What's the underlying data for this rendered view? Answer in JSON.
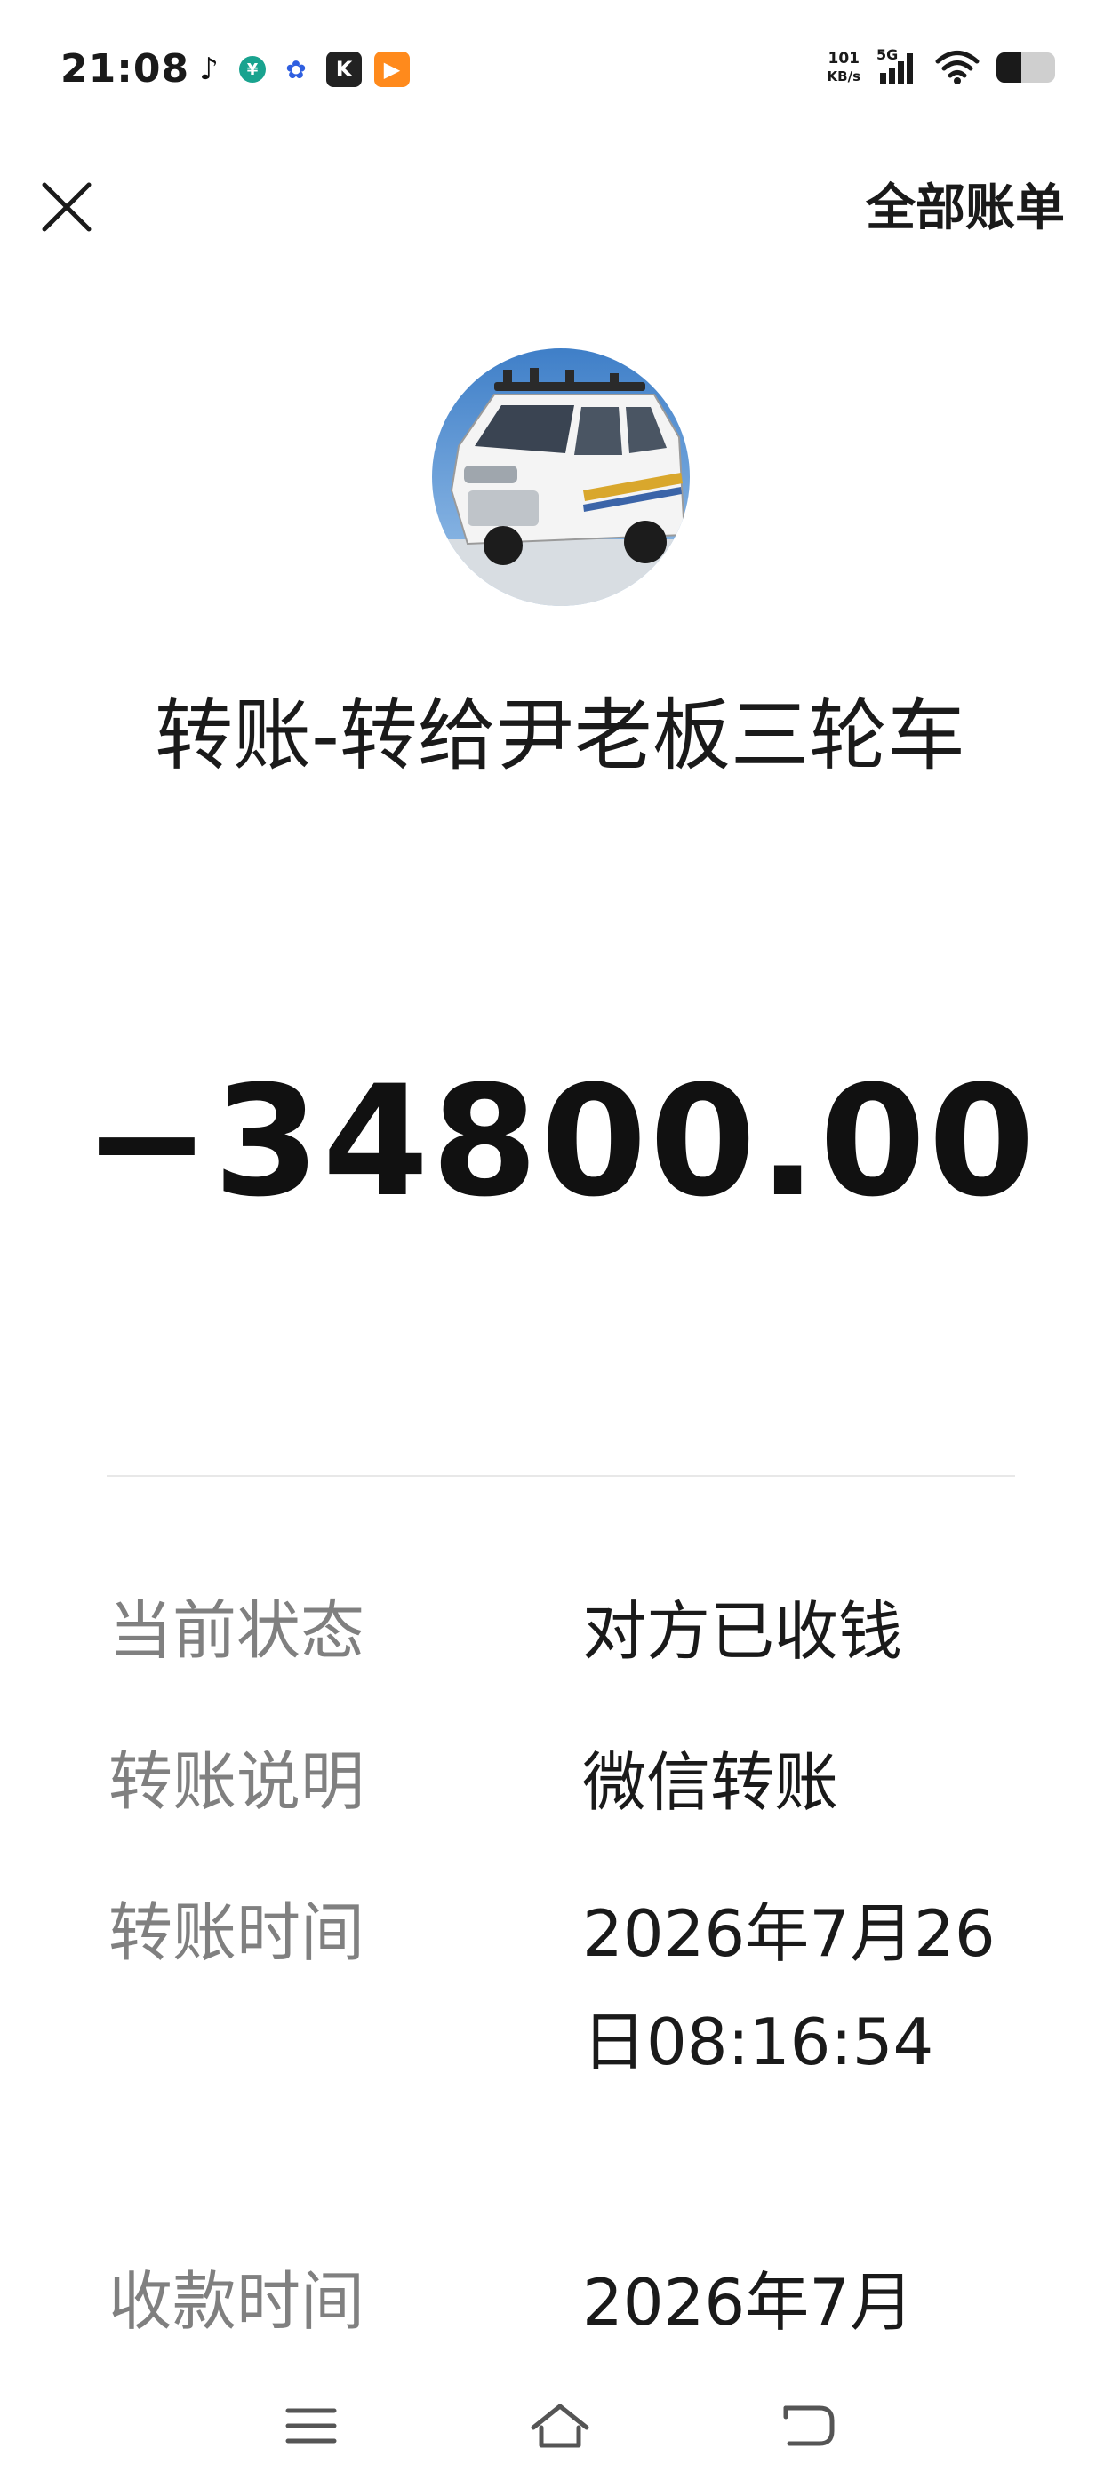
{
  "status_bar": {
    "time": "21:08",
    "net_speed_value": "101",
    "net_speed_unit": "KB/s",
    "network_type": "5G",
    "apps": [
      "tiktok-icon",
      "bank-icon",
      "baidu-icon",
      "kuaishou-icon",
      "video-icon"
    ]
  },
  "header": {
    "all_bills_label": "全部账单"
  },
  "transfer": {
    "title": "转账-转给尹老板三轮车",
    "amount": "−34800.00"
  },
  "details": [
    {
      "label": "当前状态",
      "value": "对方已收钱"
    },
    {
      "label": "转账说明",
      "value": "微信转账"
    },
    {
      "label": "转账时间",
      "value": "2026年7月26日08:16:54"
    },
    {
      "label": "收款时间",
      "value": "2026年7月"
    }
  ],
  "colors": {
    "text_primary": "#1a1a1a",
    "text_secondary": "#808080",
    "divider": "#e8e8e8"
  }
}
